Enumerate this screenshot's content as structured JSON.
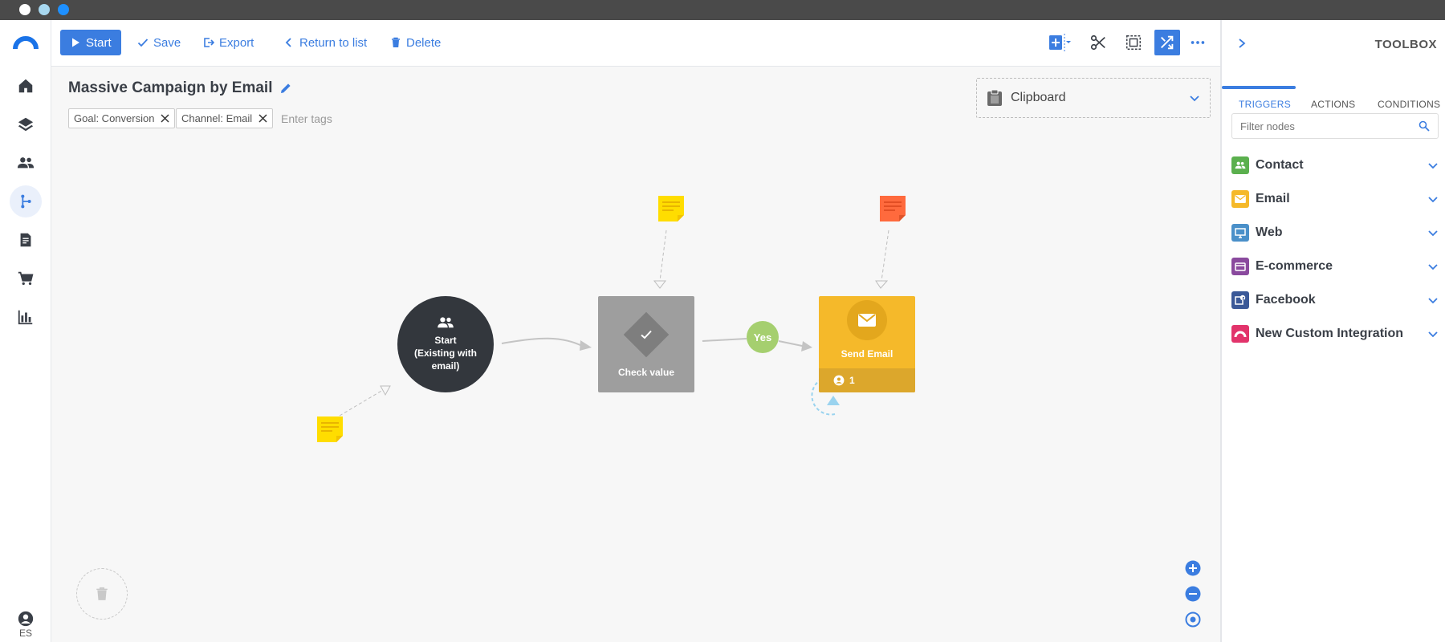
{
  "app": {
    "language": "ES"
  },
  "toolbar": {
    "start_label": "Start",
    "save_label": "Save",
    "export_label": "Export",
    "return_label": "Return to list",
    "delete_label": "Delete"
  },
  "workflow": {
    "title": "Massive Campaign by Email",
    "tags": [
      "Goal: Conversion",
      "Channel: Email"
    ],
    "tags_placeholder": "Enter tags",
    "clipboard_label": "Clipboard"
  },
  "nodes": {
    "start": {
      "line1": "Start",
      "line2": "(Existing with",
      "line3": "email)"
    },
    "check": {
      "label": "Check value"
    },
    "yes_label": "Yes",
    "email": {
      "label": "Send Email",
      "contacts": "1"
    }
  },
  "toolbox": {
    "title": "TOOLBOX",
    "tabs": [
      "TRIGGERS",
      "ACTIONS",
      "CONDITIONS"
    ],
    "active_tab": "TRIGGERS",
    "filter_placeholder": "Filter nodes",
    "categories": [
      {
        "label": "Contact",
        "color": "#5bb04e",
        "icon": "people-icon"
      },
      {
        "label": "Email",
        "color": "#f5b92a",
        "icon": "envelope-icon"
      },
      {
        "label": "Web",
        "color": "#4a90c9",
        "icon": "monitor-icon"
      },
      {
        "label": "E-commerce",
        "color": "#8a4a9e",
        "icon": "card-icon"
      },
      {
        "label": "Facebook",
        "color": "#3b5998",
        "icon": "facebook-icon"
      },
      {
        "label": "New Custom Integration",
        "color": "#e2336b",
        "icon": "integration-icon"
      }
    ]
  },
  "colors": {
    "accent": "#3b7de0",
    "start_node": "#33373d",
    "check_node": "#9e9e9e",
    "email_node": "#f5b92a",
    "yes_badge": "#a5cf6f",
    "note_yellow": "#ffdd00",
    "note_orange": "#ff6a3d"
  }
}
